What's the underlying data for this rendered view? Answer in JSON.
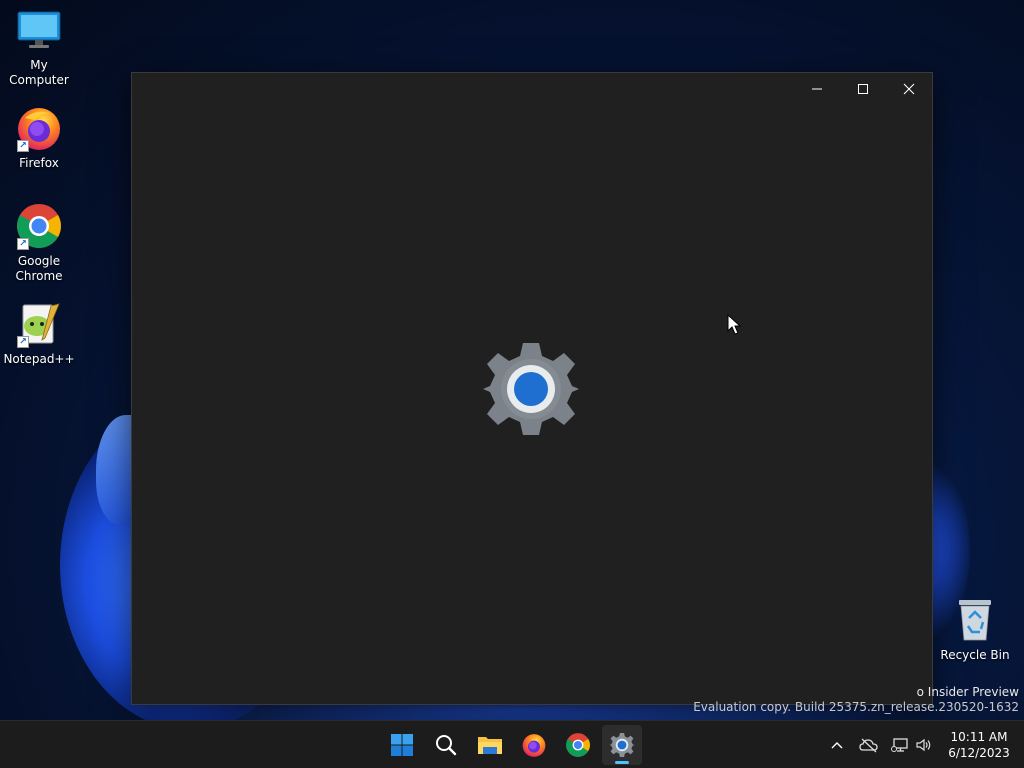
{
  "desktop": {
    "icons": [
      {
        "label": "My Computer"
      },
      {
        "label": "Firefox"
      },
      {
        "label": "Google Chrome"
      },
      {
        "label": "Notepad++"
      }
    ],
    "recycle_bin": {
      "label": "Recycle Bin"
    }
  },
  "window": {
    "splash_icon": "settings-gear-icon",
    "controls": [
      "minimize-icon",
      "maximize-icon",
      "close-icon"
    ]
  },
  "watermark": {
    "line1": "o Insider Preview",
    "line2": "Evaluation copy. Build 25375.zn_release.230520-1632"
  },
  "taskbar": {
    "apps": [
      "start-icon",
      "search-icon",
      "file-explorer-icon",
      "firefox-icon",
      "chrome-icon",
      "settings-icon"
    ],
    "active_app": "settings-icon",
    "tray": [
      "chevron-up-icon",
      "onedrive-icon",
      "network-icon",
      "volume-icon"
    ],
    "clock": {
      "time": "10:11 AM",
      "date": "6/12/2023"
    }
  },
  "colors": {
    "window_bg": "#202020",
    "taskbar_bg": "#1c1c1c",
    "accent": "#4cc2ff",
    "gear_grey": "#7b8289",
    "gear_blue": "#1e6fd0"
  }
}
